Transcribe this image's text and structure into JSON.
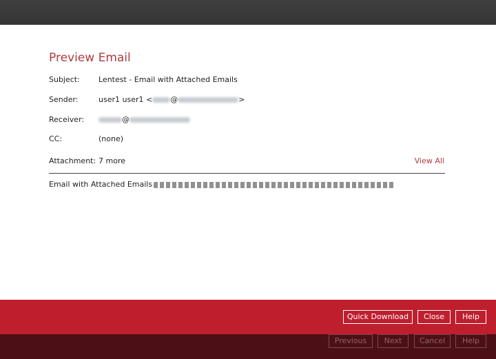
{
  "dialog": {
    "title": "Preview Email"
  },
  "fields": {
    "subject_label": "Subject:",
    "subject_value": "Lentest - Email with Attached Emails",
    "sender_label": "Sender:",
    "sender_name": "user1 user1 <",
    "sender_at": "@",
    "sender_close": ">",
    "receiver_label": "Receiver:",
    "receiver_at": "@",
    "cc_label": "CC:",
    "cc_value": "(none)",
    "attachment_label": "Attachment:",
    "attachment_value": "7 more",
    "view_all": "View All"
  },
  "body": {
    "text": "Email with Attached Emails"
  },
  "actions": {
    "quick_download": "Quick Download",
    "close": "Close",
    "help": "Help"
  },
  "wizard": {
    "previous": "Previous",
    "next": "Next",
    "cancel": "Cancel",
    "help": "Help"
  },
  "colors": {
    "title": "#b13a3f",
    "action_bar": "#bf1e2d",
    "nav_bar": "#4d0f16",
    "top_bar": "#3a3a3a"
  }
}
